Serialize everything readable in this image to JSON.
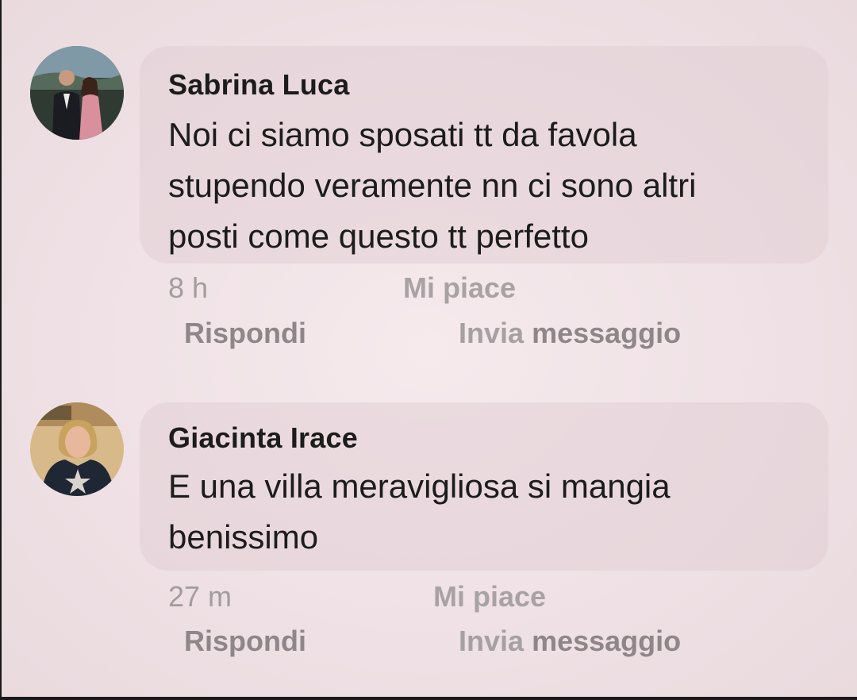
{
  "comments": [
    {
      "author": "Sabrina Luca",
      "text": "Noi ci siamo sposati tt da favola stupendo veramente nn ci sono altri posti come questo tt perfetto",
      "line1": "Noi ci siamo sposati tt da favola",
      "line2": "stupendo veramente nn ci sono altri",
      "line3": "posti come questo tt perfetto",
      "time": "8 h",
      "like_label": "Mi piace",
      "reply_label": "Rispondi",
      "message_label_1": "Invia",
      "message_label_2": "messaggio",
      "avatar_icon": "couple-photo-avatar"
    },
    {
      "author": "Giacinta Irace",
      "line1": "E una villa meravigliosa si mangia",
      "line2": "benissimo",
      "time": "27 m",
      "like_label": "Mi piace",
      "reply_label": "Rispondi",
      "message_label_1": "Invia",
      "message_label_2": "messaggio",
      "avatar_icon": "woman-photo-avatar"
    }
  ],
  "colors": {
    "bubble": "#e6d6db",
    "meta_text": "#a9a2a5",
    "text": "#1c1c1c"
  }
}
